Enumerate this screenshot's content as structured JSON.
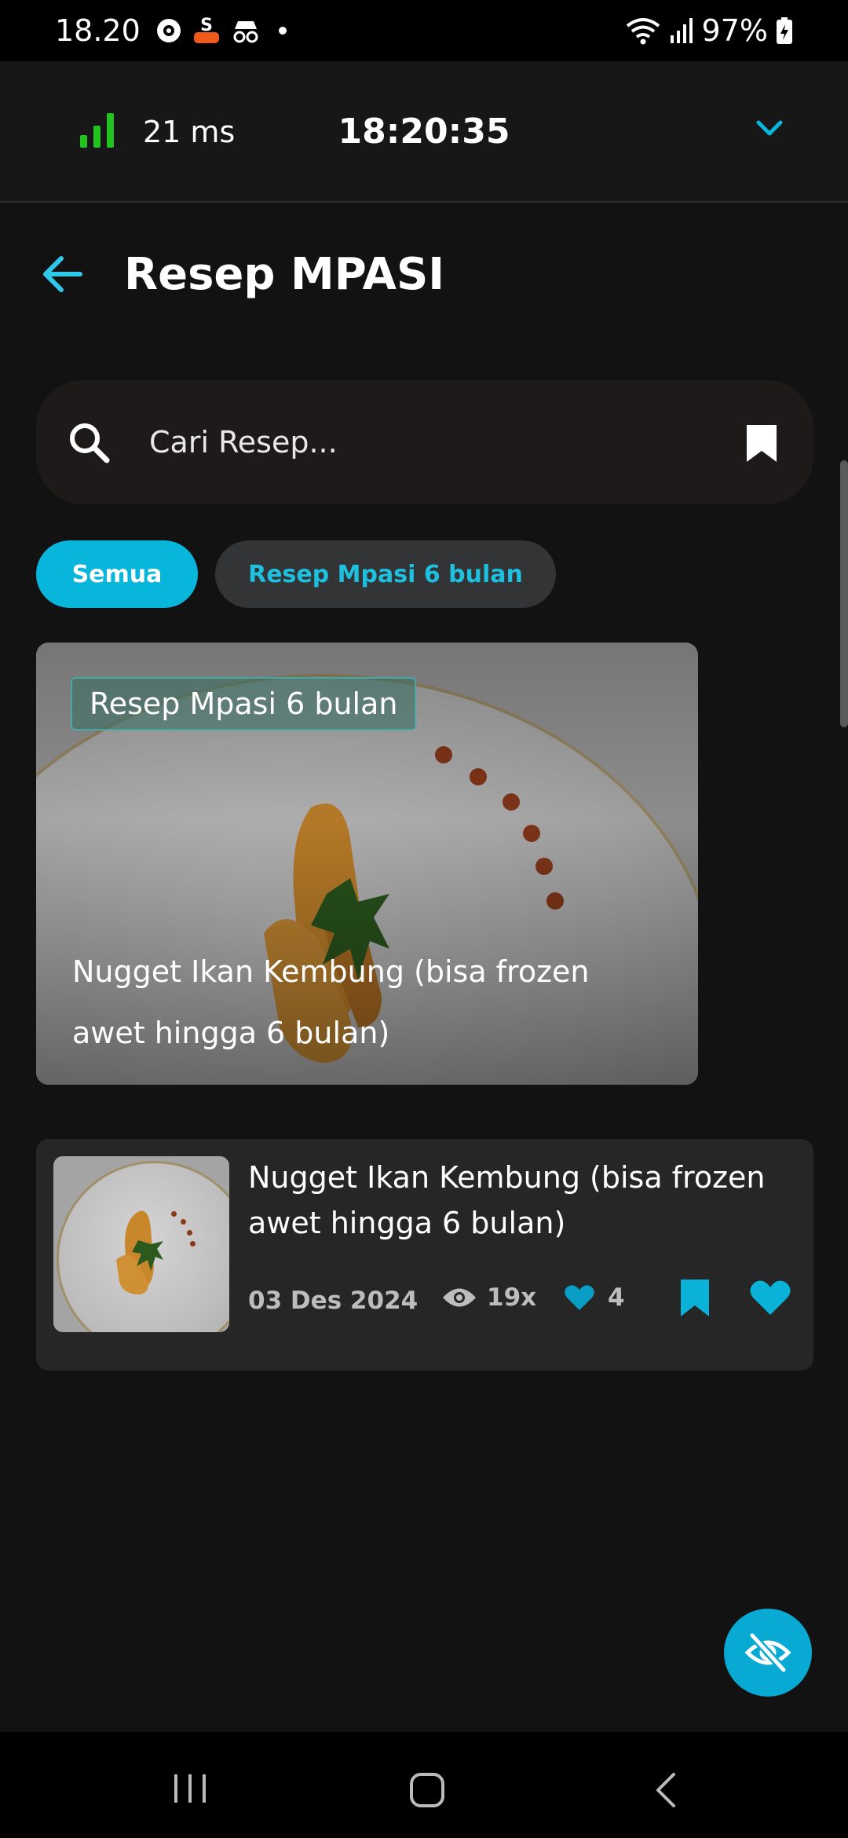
{
  "status_bar": {
    "time": "18.20",
    "battery": "97%"
  },
  "latency": {
    "ping": "21 ms",
    "clock": "18:20:35"
  },
  "header": {
    "title": "Resep MPASI"
  },
  "search": {
    "placeholder": "Cari Resep..."
  },
  "filters": [
    {
      "label": "Semua",
      "active": true
    },
    {
      "label": "Resep Mpasi 6 bulan",
      "active": false
    }
  ],
  "featured": {
    "tag": "Resep Mpasi 6 bulan",
    "title": "Nugget Ikan Kembung (bisa frozen awet hingga 6 bulan)"
  },
  "recipes": [
    {
      "title": "Nugget Ikan Kembung (bisa frozen awet hingga 6 bulan)",
      "date": "03 Des 2024",
      "views": "19x",
      "likes": "4"
    }
  ],
  "colors": {
    "accent": "#07b6da",
    "background": "#121212",
    "card": "#262626",
    "signal_green": "#22c31e"
  },
  "icons": [
    "signal-icon",
    "chevron-down-icon",
    "back-arrow-icon",
    "search-icon",
    "bookmark-icon",
    "eye-icon",
    "heart-icon",
    "eye-off-icon"
  ]
}
